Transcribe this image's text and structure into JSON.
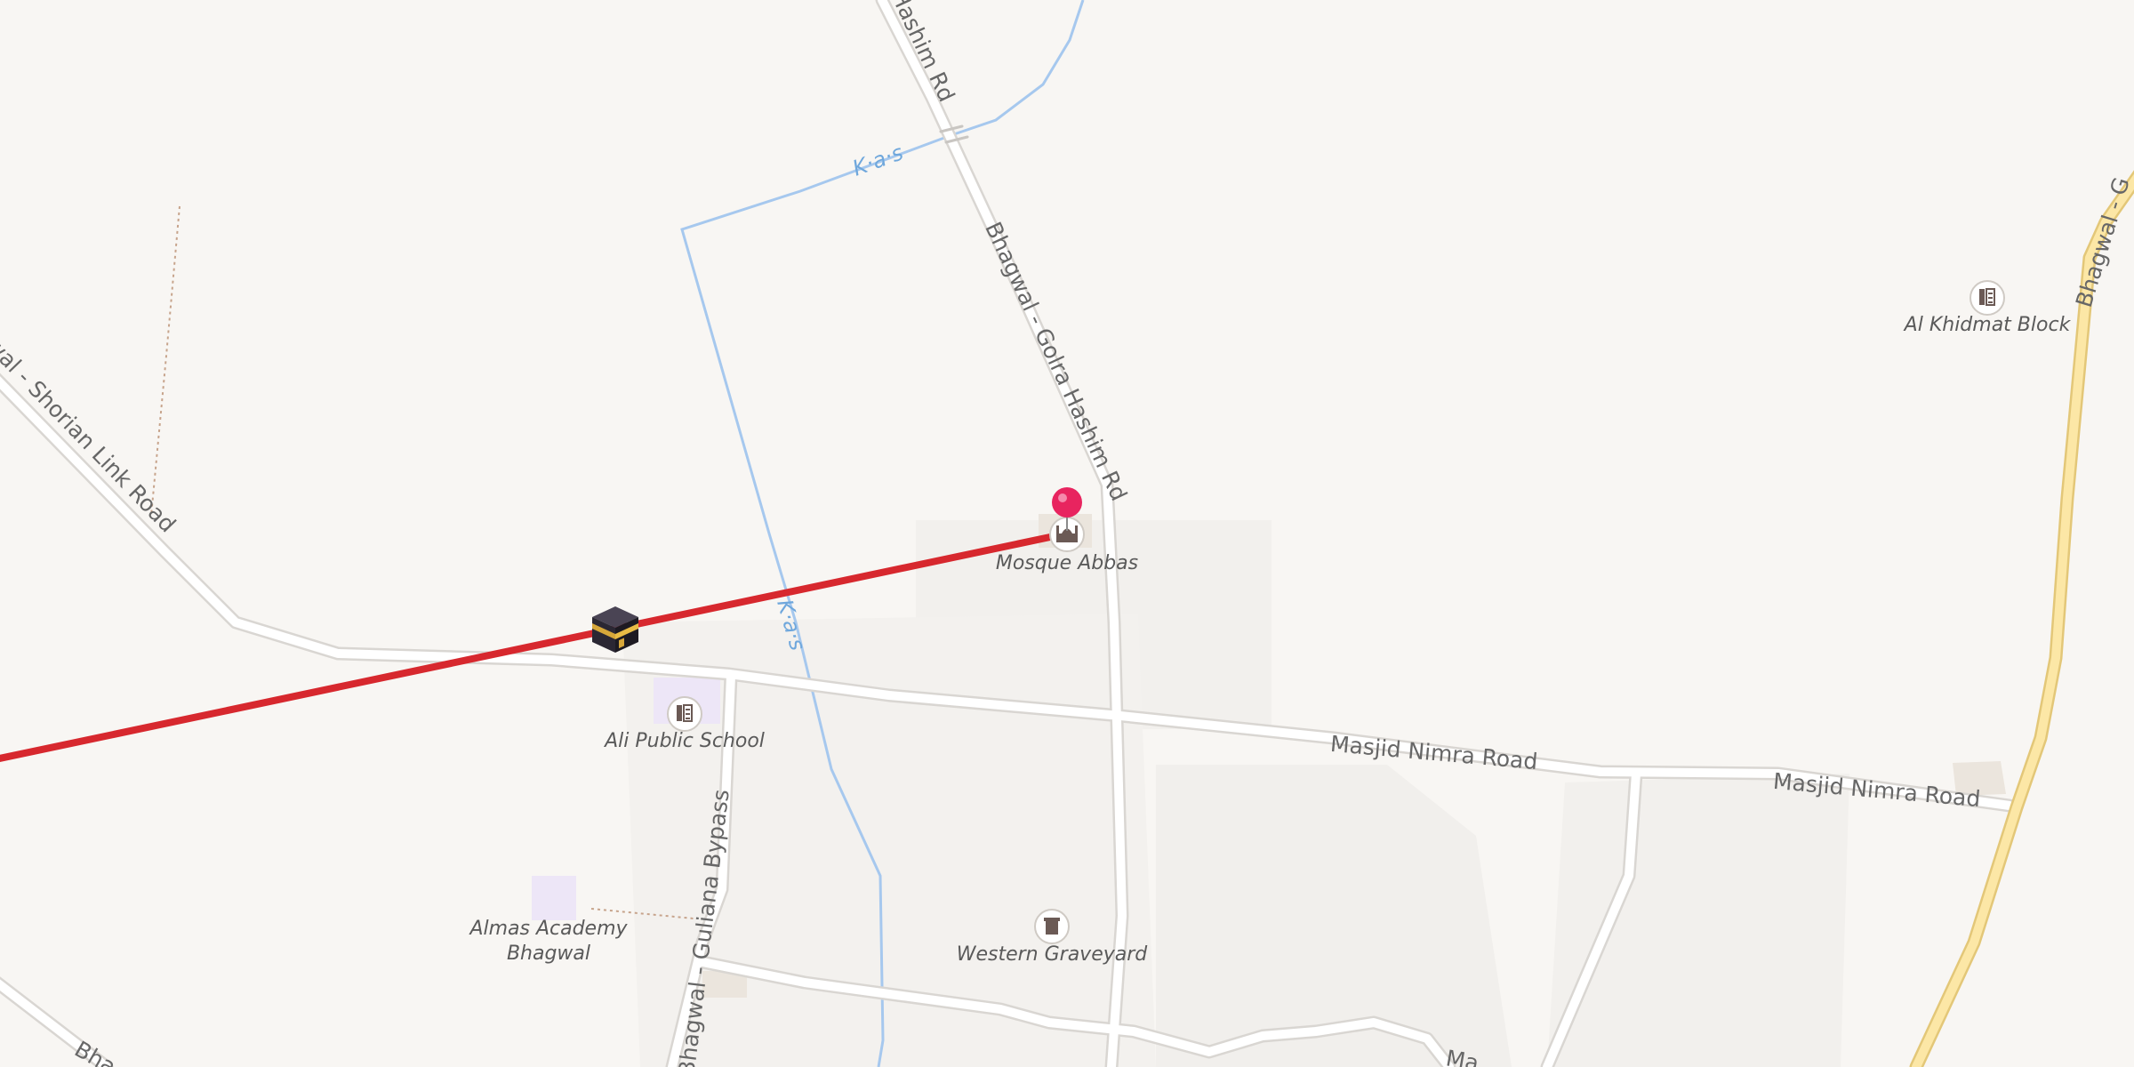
{
  "roads": {
    "golra_top": "Hashim Rd",
    "golra_main": "Bhagwal - Golra Hashim Rd",
    "shorian": "wal - Shorian Link Road",
    "masjid_nimra_1": "Masjid Nimra Road",
    "masjid_nimra_2": "Masjid Nimra Road",
    "guliana": "Bhagwal - Guliana Bypass",
    "right_highway": "Bhagwal - G",
    "bottom_left": "Bha",
    "bottom_mid": "Ma"
  },
  "water": {
    "kas_1": "K·a·s",
    "kas_2": "K·a·s"
  },
  "pois": {
    "mosque": "Mosque Abbas",
    "school": "Ali Public School",
    "academy_line1": "Almas Academy",
    "academy_line2": "Bhagwal",
    "graveyard": "Western Graveyard",
    "khidmat": "Al Khidmat Block"
  },
  "icons": {
    "qibla_marker": "kaaba-icon",
    "location_pin": "map-pin-icon",
    "mosque": "mosque-icon",
    "school": "school-icon",
    "graveyard": "graveyard-icon",
    "khidmat": "building-icon"
  },
  "colors": {
    "background": "#f8f6f3",
    "road": "#ffffff",
    "road_casing": "#d9d6d2",
    "highway": "#fce7a6",
    "water": "#a6c8ee",
    "qibla_line": "#d7282e",
    "pin": "#e8245f"
  }
}
